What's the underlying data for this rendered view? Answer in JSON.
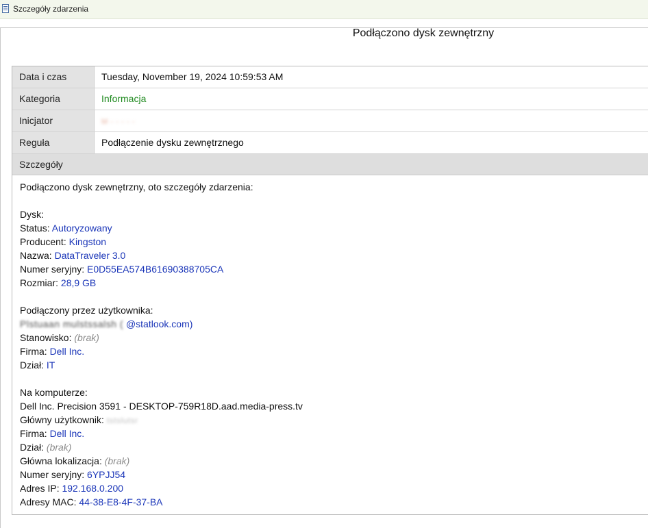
{
  "window": {
    "title": "Szczegóły zdarzenia",
    "icon": "document-icon"
  },
  "event": {
    "heading": "Podłączono dysk zewnętrzny",
    "fields": [
      {
        "label": "Data i czas",
        "value": "Tuesday, November 19, 2024 10:59:53 AM"
      },
      {
        "label": "Kategoria",
        "value": "Informacja",
        "color": "#1f8a1f"
      },
      {
        "label": "Inicjator",
        "value": "M - - - - -"
      },
      {
        "label": "Reguła",
        "value": "Podłączenie dysku zewnętrznego"
      }
    ],
    "details_header": "Szczegóły"
  },
  "details": {
    "intro": "Podłączono dysk zewnętrzny, oto szczegóły zdarzenia:",
    "disk_header": "Dysk:",
    "status_label": "Status:",
    "status_value": "Autoryzowany",
    "vendor_label": "Producent:",
    "vendor_value": "Kingston",
    "name_label": "Nazwa:",
    "name_value": "DataTraveler 3.0",
    "serial_label": "Numer seryjny:",
    "serial_value": "E0D55EA574B61690388705CA",
    "size_label": "Rozmiar:",
    "size_value": "28,9 GB",
    "user_header": "Podłączony przez użytkownika:",
    "user_blur": "Plstuaan mulstssalsh (",
    "user_email_suffix": "@statlook.com)",
    "workstation_label": "Stanowisko:",
    "workstation_value": "(brak)",
    "company_label": "Firma:",
    "company_value": "Dell Inc.",
    "dept_label": "Dział:",
    "dept_value": "IT",
    "computer_header": "Na komputerze:",
    "computer_value": "Dell Inc. Precision 3591 - DESKTOP-759R18D.aad.media-press.tv",
    "main_user_label": "Główny użytkownik:",
    "main_user_blur": "tstslutsr",
    "company2_label": "Firma:",
    "company2_value": "Dell Inc.",
    "dept2_label": "Dział:",
    "dept2_value": "(brak)",
    "location_label": "Główna lokalizacja:",
    "location_value": "(brak)",
    "serial2_label": "Numer seryjny:",
    "serial2_value": "6YPJJ54",
    "ip_label": "Adres IP:",
    "ip_value": "192.168.0.200",
    "mac_label": "Adresy MAC:",
    "mac_value": "44-38-E8-4F-37-BA"
  },
  "colors": {
    "value_blue": "#1a35b8",
    "info_green": "#1f8a1f",
    "label_bg": "#e3e3e3"
  }
}
